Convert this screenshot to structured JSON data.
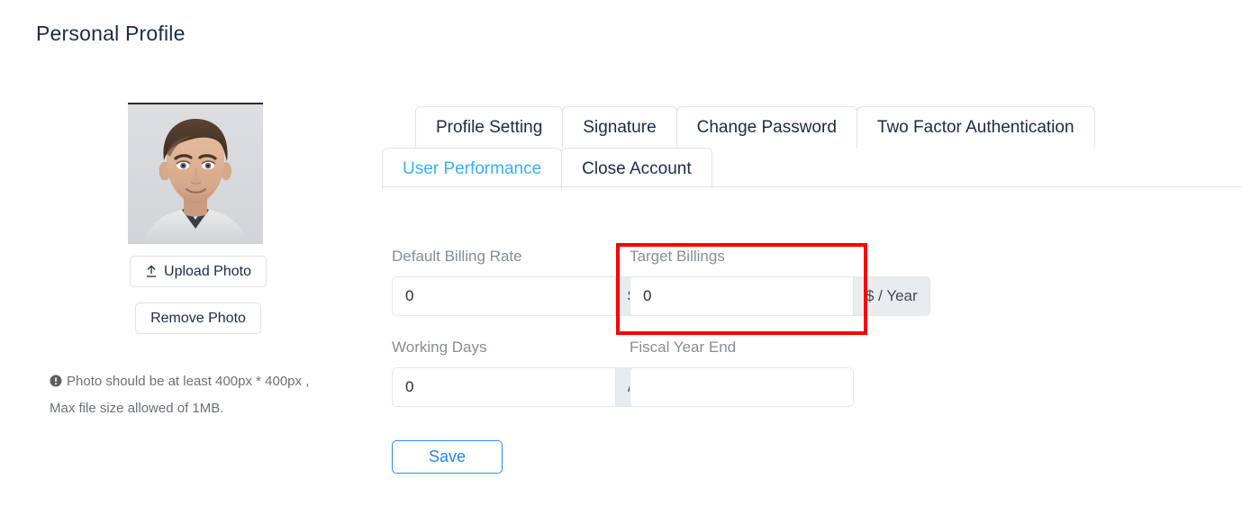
{
  "page": {
    "title": "Personal Profile"
  },
  "photo_panel": {
    "avatar_alt": "user-profile-photo",
    "upload_label": "Upload Photo",
    "upload_icon": "upload-arrow-icon",
    "remove_label": "Remove Photo",
    "hint_icon": "info-exclamation-icon",
    "hint_line1": "Photo should be at least 400px * 400px ,",
    "hint_line2": "Max file size allowed of 1MB."
  },
  "tabs": {
    "row1": [
      {
        "label": "Profile Setting",
        "active": false
      },
      {
        "label": "Signature",
        "active": false
      },
      {
        "label": "Change Password",
        "active": false
      },
      {
        "label": "Two Factor Authentication",
        "active": false
      }
    ],
    "row2": [
      {
        "label": "User Performance",
        "active": true
      },
      {
        "label": "Close Account",
        "active": false
      }
    ]
  },
  "form": {
    "default_billing_rate": {
      "label": "Default Billing Rate",
      "value": "0",
      "addon": "$ / Hr"
    },
    "target_billings": {
      "label": "Target Billings",
      "value": "0",
      "addon": "$ / Year"
    },
    "working_days": {
      "label": "Working Days",
      "value": "0",
      "addon": "/ Year"
    },
    "fiscal_year_end": {
      "label": "Fiscal Year End",
      "value": "",
      "addon": ""
    },
    "save_label": "Save"
  },
  "annotation": {
    "highlight_color": "#fb0000",
    "highlight_target": "target-billings-field"
  }
}
